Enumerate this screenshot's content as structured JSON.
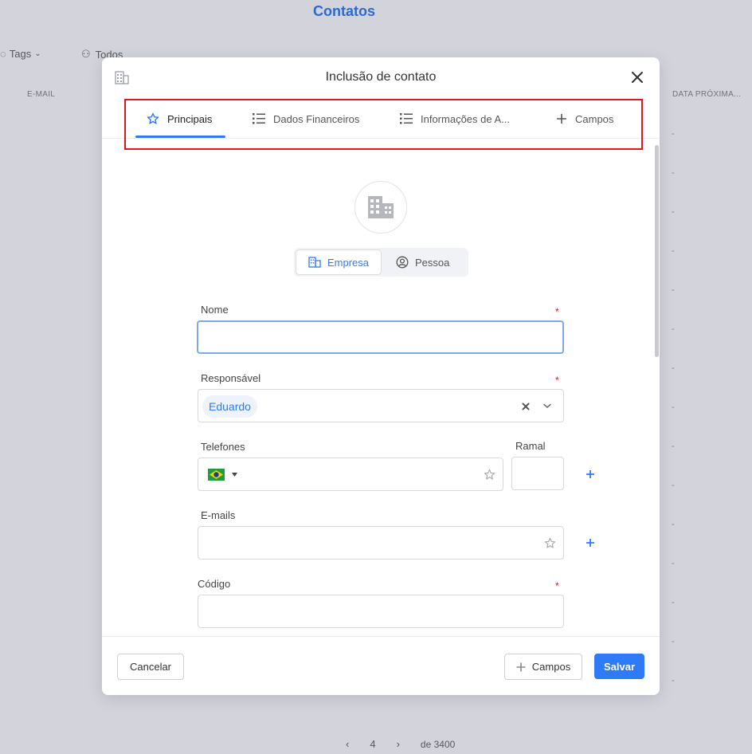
{
  "background": {
    "title": "Contatos",
    "filter_tags": "Tags",
    "filter_all": "Todos",
    "col_email": "E-MAIL",
    "col_next_date": "DATA PRÓXIMA...",
    "dash": "-",
    "pager_page": "4",
    "pager_total": "de 3400"
  },
  "modal": {
    "title": "Inclusão de contato",
    "tabs": [
      {
        "label": "Principais",
        "icon": "star-icon",
        "active": true
      },
      {
        "label": "Dados Financeiros",
        "icon": "list-icon"
      },
      {
        "label": "Informações de A...",
        "icon": "list-icon"
      },
      {
        "label": "Campos",
        "icon": "plus-icon"
      }
    ],
    "type_toggle": {
      "company": "Empresa",
      "person": "Pessoa",
      "selected": "Empresa"
    },
    "fields": {
      "name_label": "Nome",
      "name_value": "",
      "owner_label": "Responsável",
      "owner_value": "Eduardo",
      "phones_label": "Telefones",
      "extension_label": "Ramal",
      "emails_label": "E-mails",
      "code_label": "Código",
      "required_mark": "*"
    },
    "footer": {
      "cancel": "Cancelar",
      "fields": "Campos",
      "save": "Salvar"
    }
  },
  "colors": {
    "accent": "#2f7bf5",
    "required": "#e0161e",
    "highlight": "#e0161e"
  }
}
